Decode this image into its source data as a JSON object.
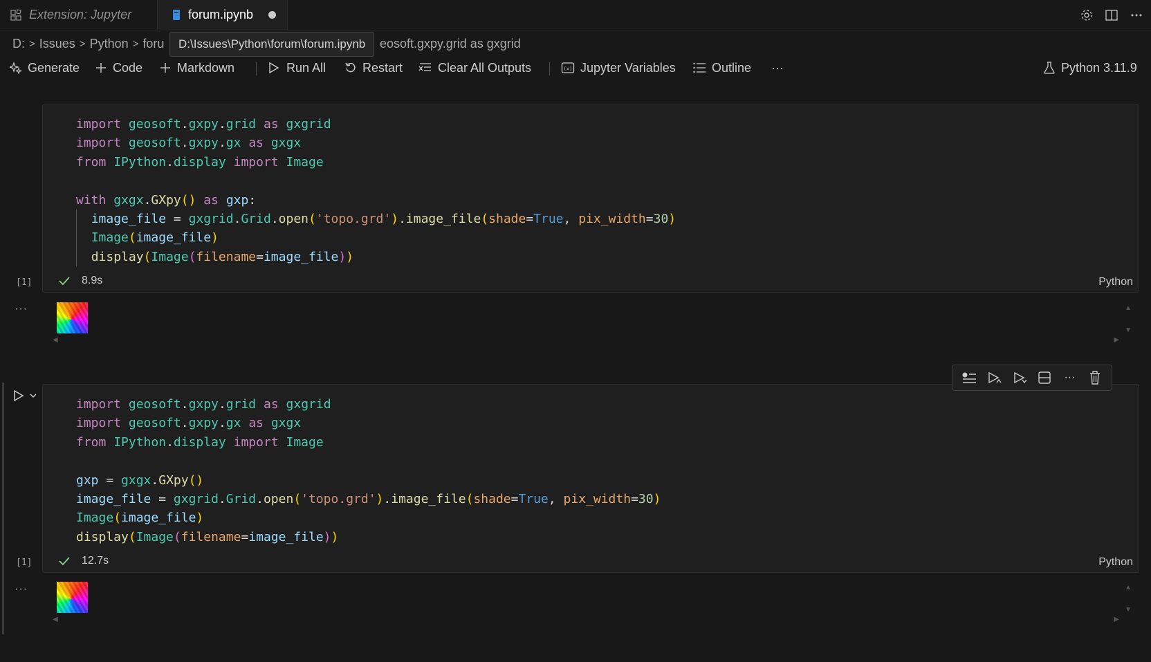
{
  "tabs": [
    {
      "label": "Extension: Jupyter"
    },
    {
      "label": "forum.ipynb",
      "dirty": true
    }
  ],
  "breadcrumb": {
    "items": [
      "D:",
      "Issues",
      "Python",
      "foru"
    ],
    "tail": "eosoft.gxpy.grid as gxgrid",
    "tooltip": "D:\\Issues\\Python\\forum\\forum.ipynb"
  },
  "toolbar": {
    "generate": "Generate",
    "code": "Code",
    "markdown": "Markdown",
    "run_all": "Run All",
    "restart": "Restart",
    "clear_outputs": "Clear All Outputs",
    "variables": "Jupyter Variables",
    "outline": "Outline",
    "more": "···",
    "kernel": "Python 3.11.9"
  },
  "cells": [
    {
      "exec_count": "[1]",
      "duration": "8.9s",
      "language": "Python",
      "output_dots": "···"
    },
    {
      "exec_count": "[1]",
      "duration": "12.7s",
      "language": "Python",
      "output_dots": "···"
    }
  ],
  "cell_toolbar_more": "···"
}
